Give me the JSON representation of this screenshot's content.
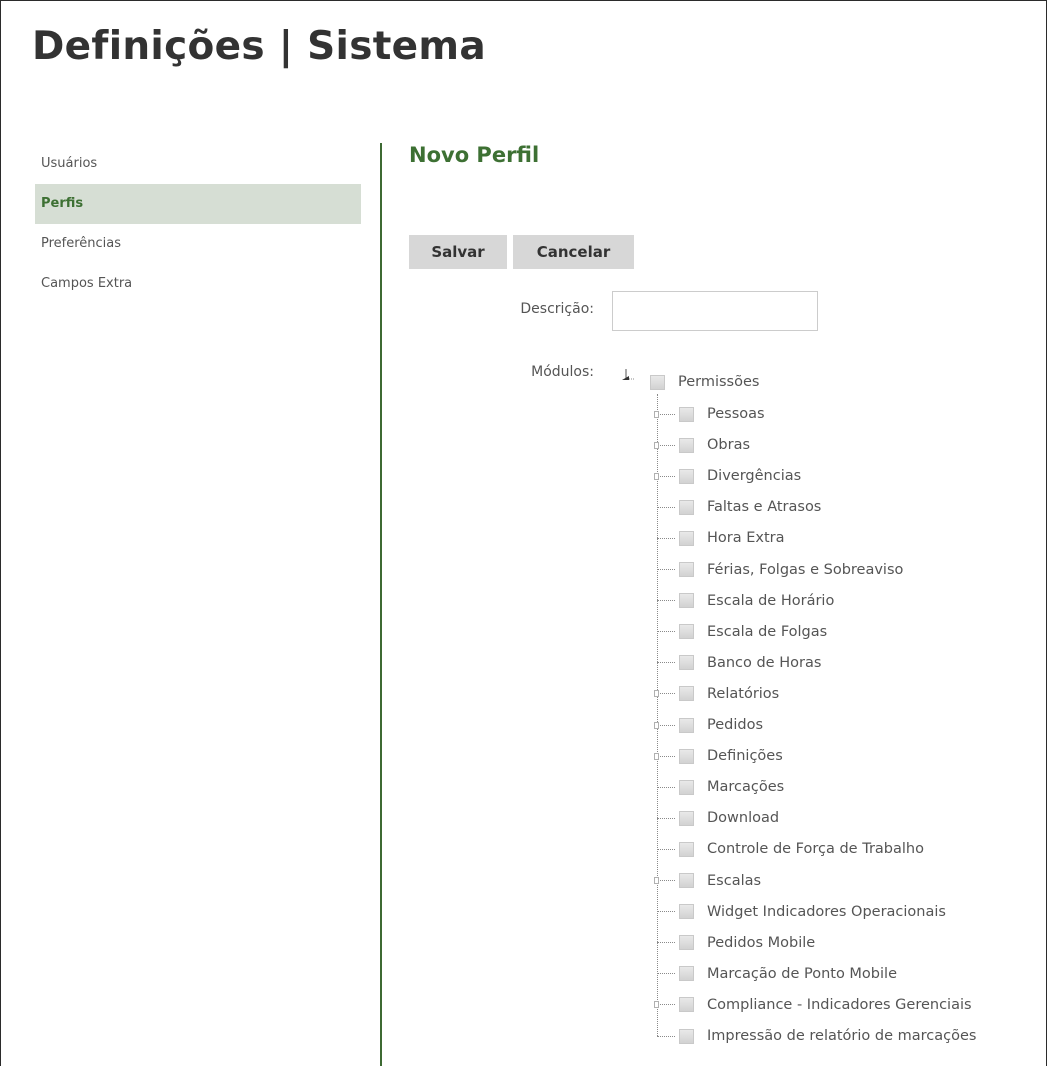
{
  "page": {
    "title": "Definições | Sistema"
  },
  "sidebar": {
    "items": [
      {
        "label": "Usuários",
        "active": false
      },
      {
        "label": "Perfis",
        "active": true
      },
      {
        "label": "Preferências",
        "active": false
      },
      {
        "label": "Campos Extra",
        "active": false
      }
    ]
  },
  "main": {
    "title": "Novo Perfil",
    "buttons": {
      "save_label": "Salvar",
      "cancel_label": "Cancelar"
    },
    "form": {
      "description_label": "Descrição:",
      "description_value": "",
      "description_placeholder": "",
      "modules_label": "Módulos:"
    },
    "tree": {
      "root": {
        "label": "Permissões",
        "checked": false,
        "expanded": true
      },
      "children": [
        {
          "label": "Pessoas",
          "expandable": true,
          "checked": false
        },
        {
          "label": "Obras",
          "expandable": true,
          "checked": false
        },
        {
          "label": "Divergências",
          "expandable": true,
          "checked": false
        },
        {
          "label": "Faltas e Atrasos",
          "expandable": false,
          "checked": false
        },
        {
          "label": "Hora Extra",
          "expandable": false,
          "checked": false
        },
        {
          "label": "Férias, Folgas e Sobreaviso",
          "expandable": false,
          "checked": false
        },
        {
          "label": "Escala de Horário",
          "expandable": false,
          "checked": false
        },
        {
          "label": "Escala de Folgas",
          "expandable": false,
          "checked": false
        },
        {
          "label": "Banco de Horas",
          "expandable": false,
          "checked": false
        },
        {
          "label": "Relatórios",
          "expandable": true,
          "checked": false
        },
        {
          "label": "Pedidos",
          "expandable": true,
          "checked": false
        },
        {
          "label": "Definições",
          "expandable": true,
          "checked": false
        },
        {
          "label": "Marcações",
          "expandable": false,
          "checked": false
        },
        {
          "label": "Download",
          "expandable": false,
          "checked": false
        },
        {
          "label": "Controle de Força de Trabalho",
          "expandable": false,
          "checked": false
        },
        {
          "label": "Escalas",
          "expandable": true,
          "checked": false
        },
        {
          "label": "Widget Indicadores Operacionais",
          "expandable": false,
          "checked": false
        },
        {
          "label": "Pedidos Mobile",
          "expandable": false,
          "checked": false
        },
        {
          "label": "Marcação de Ponto Mobile",
          "expandable": false,
          "checked": false
        },
        {
          "label": "Compliance - Indicadores Gerenciais",
          "expandable": true,
          "checked": false
        },
        {
          "label": "Impressão de relatório de marcações",
          "expandable": false,
          "checked": false
        }
      ]
    }
  },
  "colors": {
    "accent_green": "#3d7033",
    "active_bg": "#d6ded4",
    "button_bg": "#d7d7d7"
  }
}
